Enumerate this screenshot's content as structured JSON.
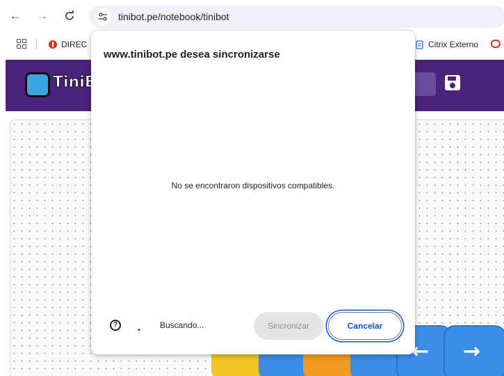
{
  "browser": {
    "url": "tinibot.pe/notebook/tinibot",
    "nav": {
      "back": "←",
      "forward": "→",
      "reload": "C"
    },
    "bookmarks": [
      {
        "label": "DIREC"
      },
      {
        "label": "Citrix Externo"
      }
    ]
  },
  "app": {
    "logo_text": "TiniB"
  },
  "dialog": {
    "title": "www.tinibot.pe desea sincronizarse",
    "message": "No se encontraron dispositivos compatibles.",
    "help_glyph": "?",
    "status": "Buscando...",
    "sync_label": "Sincronizar",
    "cancel_label": "Cancelar"
  },
  "blocks": {
    "left_arrow": "←",
    "right_arrow": "→"
  },
  "colors": {
    "header": "#4a237a",
    "primary": "#0b57d0",
    "block_blue": "#3c8de8",
    "block_yellow": "#f3c623",
    "block_orange": "#f29a1d"
  }
}
